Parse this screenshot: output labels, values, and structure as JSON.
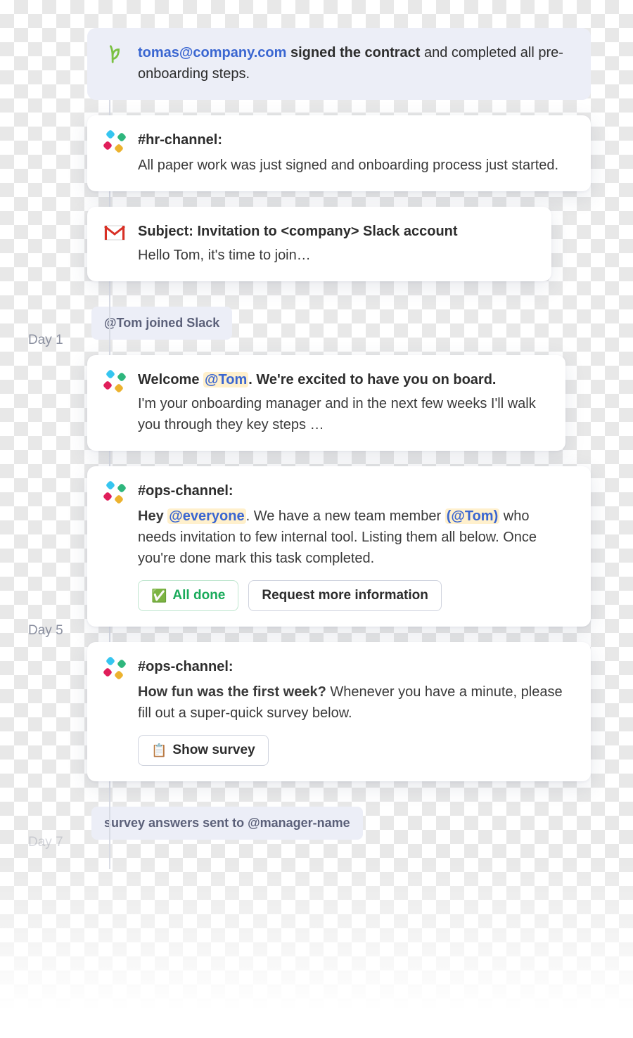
{
  "labels": {
    "day1": "Day 1",
    "day5": "Day 5",
    "day7": "Day 7"
  },
  "pills": {
    "joined_slack": "@Tom joined Slack",
    "survey_sent": "survey answers sent to @manager-name"
  },
  "card_contract": {
    "email": "tomas@company.com",
    "strong_tail": " signed the contract",
    "rest": " and completed all pre-onboarding steps."
  },
  "card_hr": {
    "channel": "#hr-channel:",
    "body": "All paper work was just signed and onboarding process just started."
  },
  "card_gmail": {
    "subject": "Subject: Invitation to <company> Slack account",
    "body": "Hello Tom, it's time to join…"
  },
  "card_welcome": {
    "lead": "Welcome ",
    "mention": "@Tom",
    "after_mention": ". We're excited to have you on board.",
    "body": "I'm your onboarding manager and in the next few weeks I'll walk you through they key steps …"
  },
  "card_ops1": {
    "channel": "#ops-channel:",
    "lead": "Hey ",
    "mention_everyone": "@everyone",
    "after_everyone": ". We have a new team member ",
    "mention_tom": "(@Tom)",
    "rest": " who needs invitation to few internal tool. Listing them all below. Once you're done mark this task completed.",
    "btn_done": "All done",
    "btn_more": "Request more information"
  },
  "card_ops2": {
    "channel": "#ops-channel:",
    "lead_strong": "How fun was the first week?",
    "rest": " Whenever you have a minute, please fill out a super-quick survey below.",
    "btn_survey": "Show survey"
  },
  "icons": {
    "check": "✅",
    "clipboard": "📋"
  }
}
